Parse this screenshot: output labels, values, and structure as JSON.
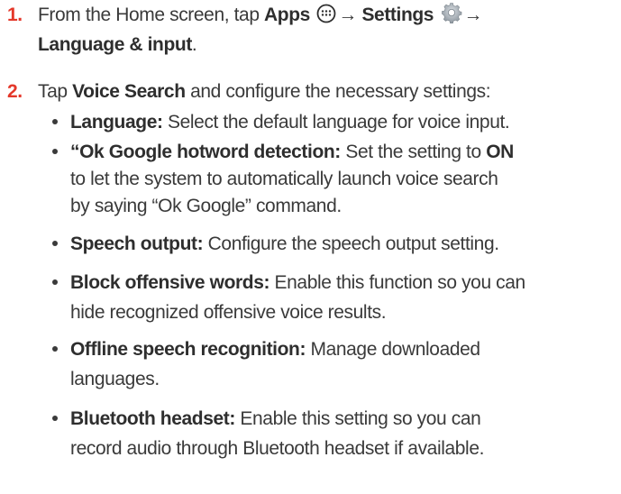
{
  "steps": [
    {
      "number": "1.",
      "text_pre": "From the Home screen, tap ",
      "apps_label": "Apps",
      "arrow1": "→",
      "settings_label": "Settings",
      "arrow2": "→",
      "line2_bold": "Language & input",
      "line2_end": "."
    },
    {
      "number": "2.",
      "text_pre": "Tap ",
      "voice_search_label": "Voice Search",
      "text_post": " and configure the necessary settings:"
    }
  ],
  "bullets": [
    {
      "term": "Language:",
      "line1": " Select the default language for voice input."
    },
    {
      "term": "“Ok Google hotword detection:",
      "line1": " Set the setting to ",
      "on_label": "ON",
      "line2": "to let the system to automatically launch voice search",
      "line3": "by saying “Ok Google” command."
    },
    {
      "term": "Speech output:",
      "line1": " Configure the speech output setting."
    },
    {
      "term": "Block offensive words:",
      "line1": " Enable this function so you can",
      "line2": "hide recognized offensive voice results."
    },
    {
      "term": "Offline speech recognition:",
      "line1": " Manage downloaded",
      "line2": "languages."
    },
    {
      "term": "Bluetooth headset:",
      "line1": " Enable this setting so you can",
      "line2": "record audio through Bluetooth headset if available."
    }
  ],
  "icons": {
    "apps": "apps-grid-icon",
    "settings": "gear-icon"
  },
  "colors": {
    "step_number": "#e4382a",
    "body_text": "#3a3a3a"
  }
}
